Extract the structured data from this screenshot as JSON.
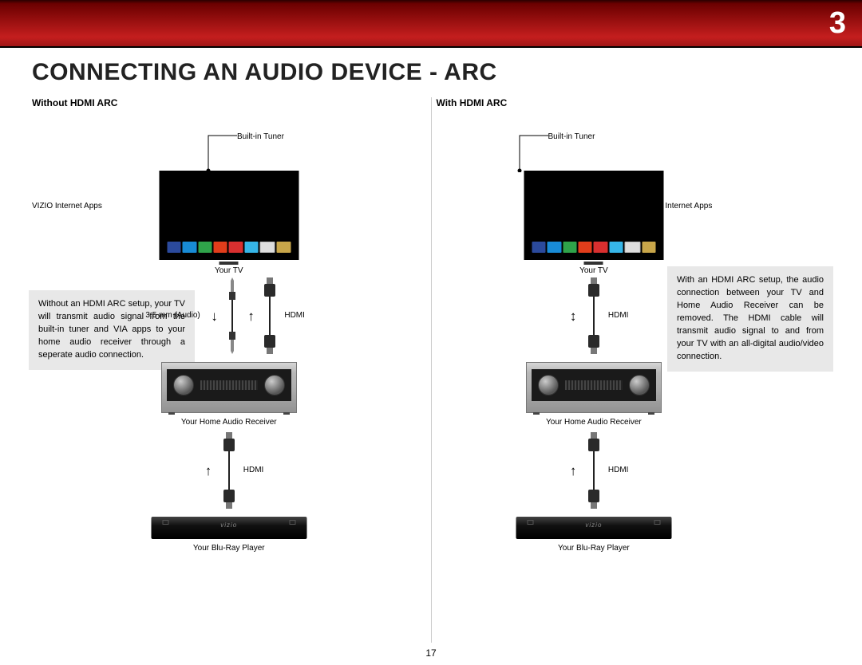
{
  "chapter_number": "3",
  "title": "CONNECTING AN AUDIO DEVICE - ARC",
  "page_number": "17",
  "left": {
    "heading": "Without HDMI ARC",
    "callouts": {
      "tuner": "Built-in Tuner",
      "via": "VIZIO Internet Apps"
    },
    "labels": {
      "tv": "Your TV",
      "audio35": "3.5 mm (Audio)",
      "hdmi": "HDMI",
      "receiver": "Your Home Audio Receiver",
      "hdmi2": "HDMI",
      "bluray": "Your Blu-Ray Player"
    },
    "textbox": "Without an HDMI ARC setup, your TV will transmit audio signal from the built-in tuner and VIA apps to your home audio receiver through a seperate audio connection."
  },
  "right": {
    "heading": "With HDMI ARC",
    "callouts": {
      "tuner": "Built-in Tuner",
      "via": "VIZIO Internet Apps"
    },
    "labels": {
      "tv": "Your TV",
      "hdmi": "HDMI",
      "receiver": "Your Home Audio Receiver",
      "hdmi2": "HDMI",
      "bluray": "Your Blu-Ray Player"
    },
    "textbox": "With an HDMI ARC setup, the audio connection between your TV and Home Audio Receiver can be removed. The HDMI cable will transmit audio signal to and from your TV with an all-digital audio/video connection."
  }
}
